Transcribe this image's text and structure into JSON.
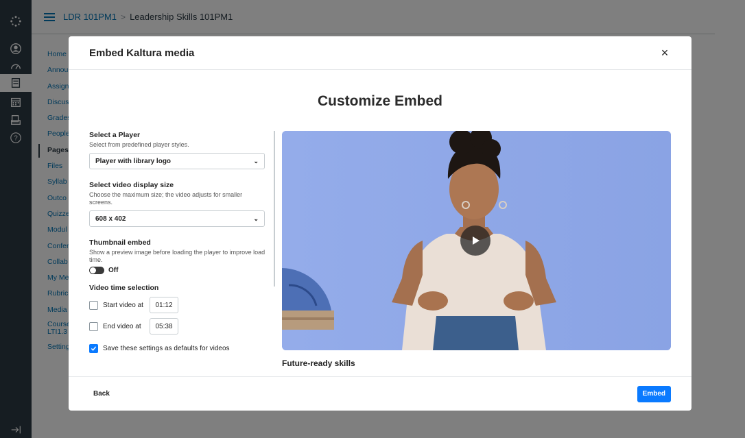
{
  "header": {
    "course_code": "LDR 101PM1",
    "separator": ">",
    "page_title": "Leadership Skills 101PM1"
  },
  "course_menu": [
    {
      "label": "Home"
    },
    {
      "label": "Annou"
    },
    {
      "label": "Assign"
    },
    {
      "label": "Discus"
    },
    {
      "label": "Grades"
    },
    {
      "label": "People"
    },
    {
      "label": "Pages"
    },
    {
      "label": "Files"
    },
    {
      "label": "Syllab"
    },
    {
      "label": "Outco"
    },
    {
      "label": "Quizze"
    },
    {
      "label": "Modul"
    },
    {
      "label": "Confer"
    },
    {
      "label": "Collab"
    },
    {
      "label": "My Me"
    },
    {
      "label": "Rubric"
    },
    {
      "label": "Media"
    },
    {
      "label": "Course LTI1.3"
    },
    {
      "label": "Setting"
    }
  ],
  "modal": {
    "title": "Embed Kaltura media",
    "close_label": "×",
    "heading": "Customize Embed",
    "player": {
      "label": "Select a Player",
      "help": "Select from predefined player styles.",
      "value": "Player with library logo"
    },
    "display_size": {
      "label": "Select video display size",
      "help": "Choose the maximum size; the video adjusts for smaller screens.",
      "value": "608 x 402"
    },
    "thumbnail": {
      "label": "Thumbnail embed",
      "help": "Show a preview image before loading the player to improve load time.",
      "toggle_text": "Off",
      "enabled": false
    },
    "time_selection": {
      "label": "Video time selection",
      "start_label": "Start video at",
      "start_value": "01:12",
      "start_checked": false,
      "end_label": "End video at",
      "end_value": "05:38",
      "end_checked": false
    },
    "save_defaults": {
      "label": "Save these settings as defaults for videos",
      "checked": true
    },
    "video_caption": "Future-ready skills",
    "back_label": "Back",
    "embed_label": "Embed"
  },
  "colors": {
    "nav_bg": "#2d3b45",
    "link": "#0374b5",
    "primary": "#0a7aff",
    "video_bg": "#8fa8e6"
  }
}
